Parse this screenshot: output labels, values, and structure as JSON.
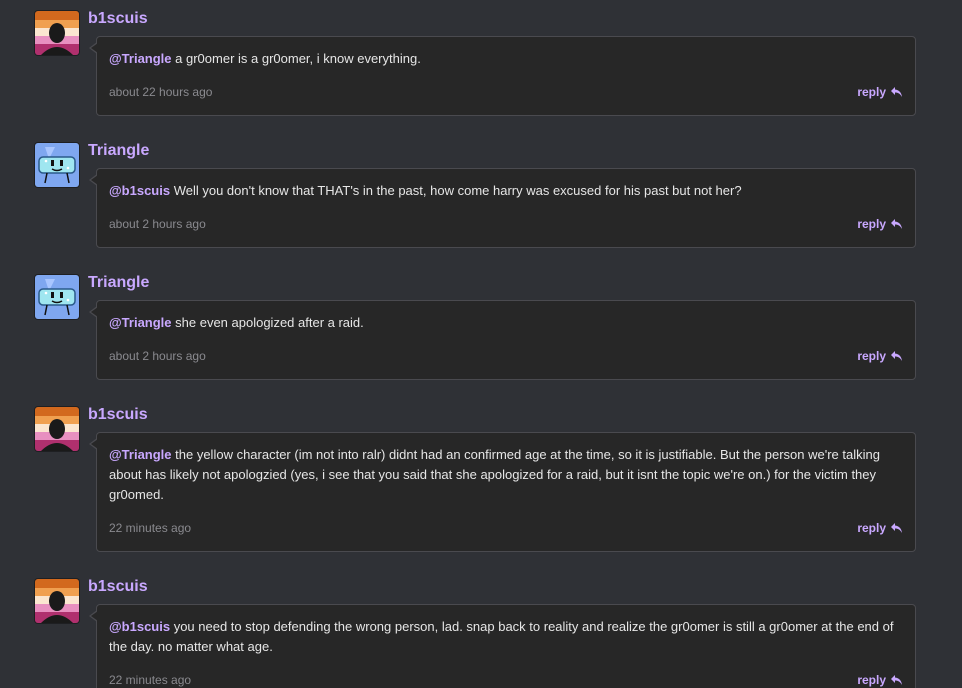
{
  "comments": [
    {
      "username": "b1scuis",
      "avatar": "orange-sunset-avatar",
      "mention": "@Triangle",
      "text": " a gr0omer is a gr0omer, i know everything.",
      "time": "about 22 hours ago",
      "reply_label": "reply"
    },
    {
      "username": "Triangle",
      "avatar": "blue-triangle-character-avatar",
      "mention": "@b1scuis",
      "text": " Well you don't know that THAT's in the past, how come harry was excused for his past but not her?",
      "time": "about 2 hours ago",
      "reply_label": "reply"
    },
    {
      "username": "Triangle",
      "avatar": "blue-triangle-character-avatar",
      "mention": "@Triangle",
      "text": " she even apologized after a raid.",
      "time": "about 2 hours ago",
      "reply_label": "reply"
    },
    {
      "username": "b1scuis",
      "avatar": "orange-sunset-avatar",
      "mention": "@Triangle",
      "text": " the yellow character (im not into ralr) didnt had an confirmed age at the time, so it is justifiable. But the person we're talking about has likely not apologzied (yes, i see that you said that she apologized for a raid, but it isnt the topic we're on.) for the victim they gr0omed.",
      "time": "22 minutes ago",
      "reply_label": "reply"
    },
    {
      "username": "b1scuis",
      "avatar": "orange-sunset-avatar",
      "mention": "@b1scuis",
      "text": " you need to stop defending the wrong person, lad. snap back to reality and realize the gr0omer is still a gr0omer at the end of the day. no matter what age.",
      "time": "22 minutes ago",
      "reply_label": "reply"
    }
  ],
  "colors": {
    "background": "#2f3136",
    "bubble": "#272727",
    "accent": "#c9a8ff",
    "muted": "#8a8a8f"
  }
}
